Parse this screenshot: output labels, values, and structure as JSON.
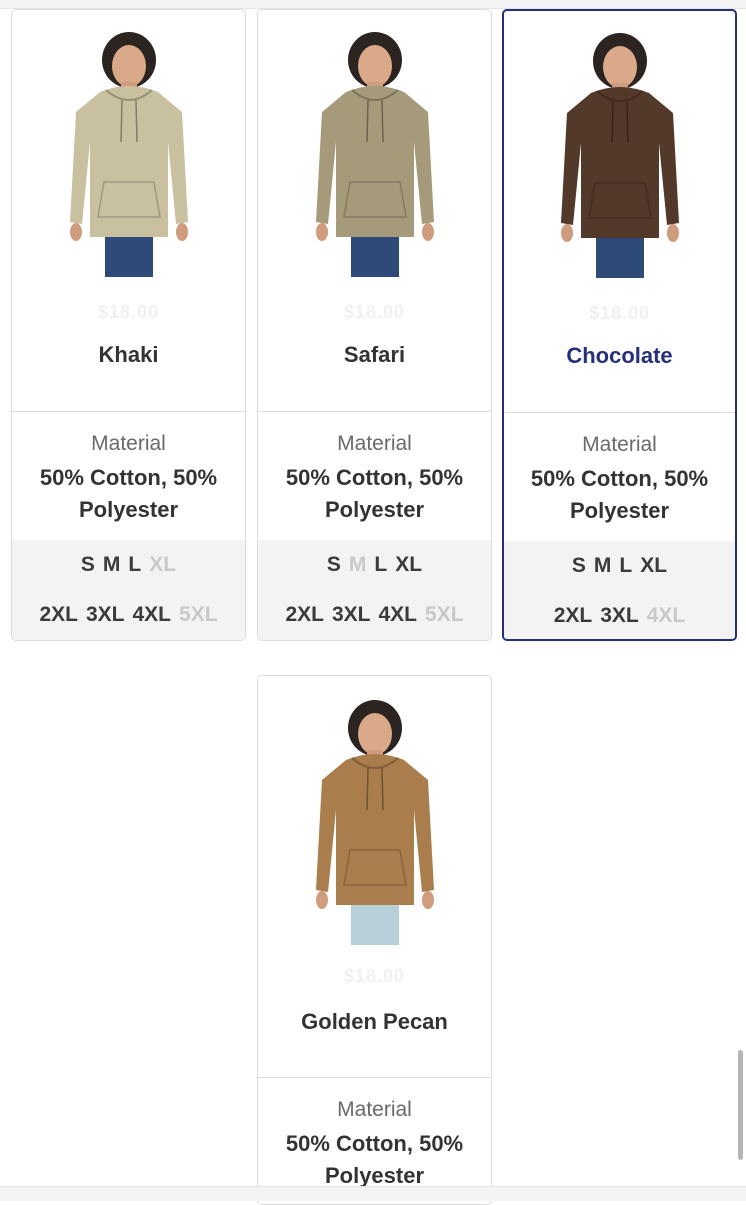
{
  "cards": [
    {
      "color_name": "Khaki",
      "price": "$18.00",
      "material_label": "Material",
      "material_value": "50% Cotton, 50% Polyester",
      "sizes_row1": [
        {
          "label": "S",
          "available": true
        },
        {
          "label": "M",
          "available": true
        },
        {
          "label": "L",
          "available": true
        },
        {
          "label": "XL",
          "available": false
        }
      ],
      "sizes_row2": [
        {
          "label": "2XL",
          "available": true
        },
        {
          "label": "3XL",
          "available": true
        },
        {
          "label": "4XL",
          "available": true
        },
        {
          "label": "5XL",
          "available": false
        }
      ],
      "hoodie_color": "#c9c0a0",
      "selected": false
    },
    {
      "color_name": "Safari",
      "price": "$18.00",
      "material_label": "Material",
      "material_value": "50% Cotton, 50% Polyester",
      "sizes_row1": [
        {
          "label": "S",
          "available": true
        },
        {
          "label": "M",
          "available": false
        },
        {
          "label": "L",
          "available": true
        },
        {
          "label": "XL",
          "available": true
        }
      ],
      "sizes_row2": [
        {
          "label": "2XL",
          "available": true
        },
        {
          "label": "3XL",
          "available": true
        },
        {
          "label": "4XL",
          "available": true
        },
        {
          "label": "5XL",
          "available": false
        }
      ],
      "hoodie_color": "#a59a7a",
      "selected": false
    },
    {
      "color_name": "Chocolate",
      "price": "$18.00",
      "material_label": "Material",
      "material_value": "50% Cotton, 50% Polyester",
      "sizes_row1": [
        {
          "label": "S",
          "available": true
        },
        {
          "label": "M",
          "available": true
        },
        {
          "label": "L",
          "available": true
        },
        {
          "label": "XL",
          "available": true
        }
      ],
      "sizes_row2": [
        {
          "label": "2XL",
          "available": true
        },
        {
          "label": "3XL",
          "available": true
        },
        {
          "label": "4XL",
          "available": false
        }
      ],
      "hoodie_color": "#53392a",
      "selected": true
    },
    {
      "color_name": "Golden Pecan",
      "price": "$18.00",
      "material_label": "Material",
      "material_value": "50% Cotton, 50% Polyester",
      "hoodie_color": "#a97d4c",
      "selected": false
    }
  ],
  "colors": {
    "selected_border": "#26307a",
    "unavailable_size": "#c8c8c8",
    "sizes_background": "#f3f3f3"
  }
}
